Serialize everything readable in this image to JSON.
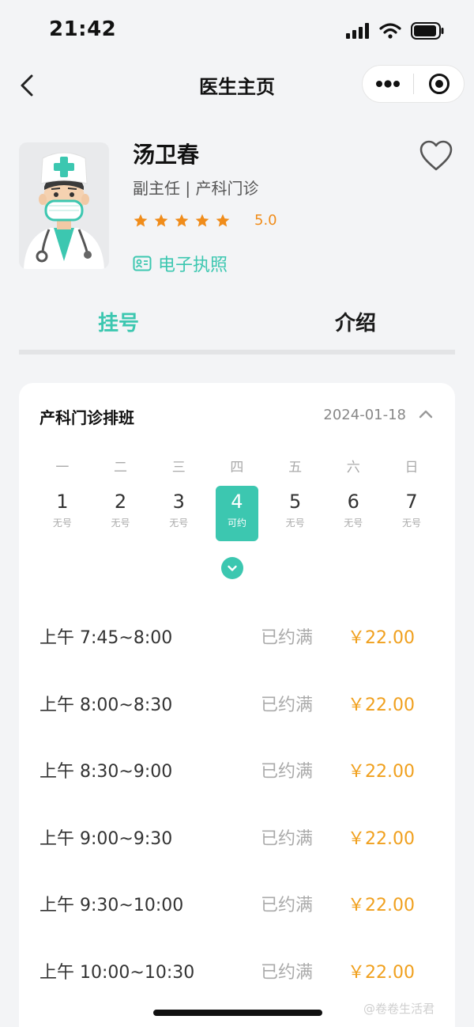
{
  "status_bar": {
    "time": "21:42"
  },
  "nav": {
    "title": "医生主页"
  },
  "doctor": {
    "name": "汤卫春",
    "title": "副主任 | 产科门诊",
    "stars": 5,
    "rating": "5.0",
    "license_label": "电子执照"
  },
  "tabs": {
    "register": "挂号",
    "intro": "介绍"
  },
  "schedule": {
    "title": "产科门诊排班",
    "date": "2024-01-18",
    "weekdays": [
      "一",
      "二",
      "三",
      "四",
      "五",
      "六",
      "日"
    ],
    "days": [
      {
        "num": "1",
        "status": "无号",
        "selected": false
      },
      {
        "num": "2",
        "status": "无号",
        "selected": false
      },
      {
        "num": "3",
        "status": "无号",
        "selected": false
      },
      {
        "num": "4",
        "status": "可约",
        "selected": true
      },
      {
        "num": "5",
        "status": "无号",
        "selected": false
      },
      {
        "num": "6",
        "status": "无号",
        "selected": false
      },
      {
        "num": "7",
        "status": "无号",
        "selected": false
      }
    ],
    "slots": [
      {
        "time": "上午 7:45~8:00",
        "status": "已约满",
        "price": "￥22.00"
      },
      {
        "time": "上午 8:00~8:30",
        "status": "已约满",
        "price": "￥22.00"
      },
      {
        "time": "上午 8:30~9:00",
        "status": "已约满",
        "price": "￥22.00"
      },
      {
        "time": "上午 9:00~9:30",
        "status": "已约满",
        "price": "￥22.00"
      },
      {
        "time": "上午 9:30~10:00",
        "status": "已约满",
        "price": "￥22.00"
      },
      {
        "time": "上午 10:00~10:30",
        "status": "已约满",
        "price": "￥22.00"
      }
    ]
  },
  "watermark": "@卷卷生活君",
  "colors": {
    "accent": "#3cc7b0",
    "price": "#f0a01e",
    "star": "#f08c1a"
  }
}
